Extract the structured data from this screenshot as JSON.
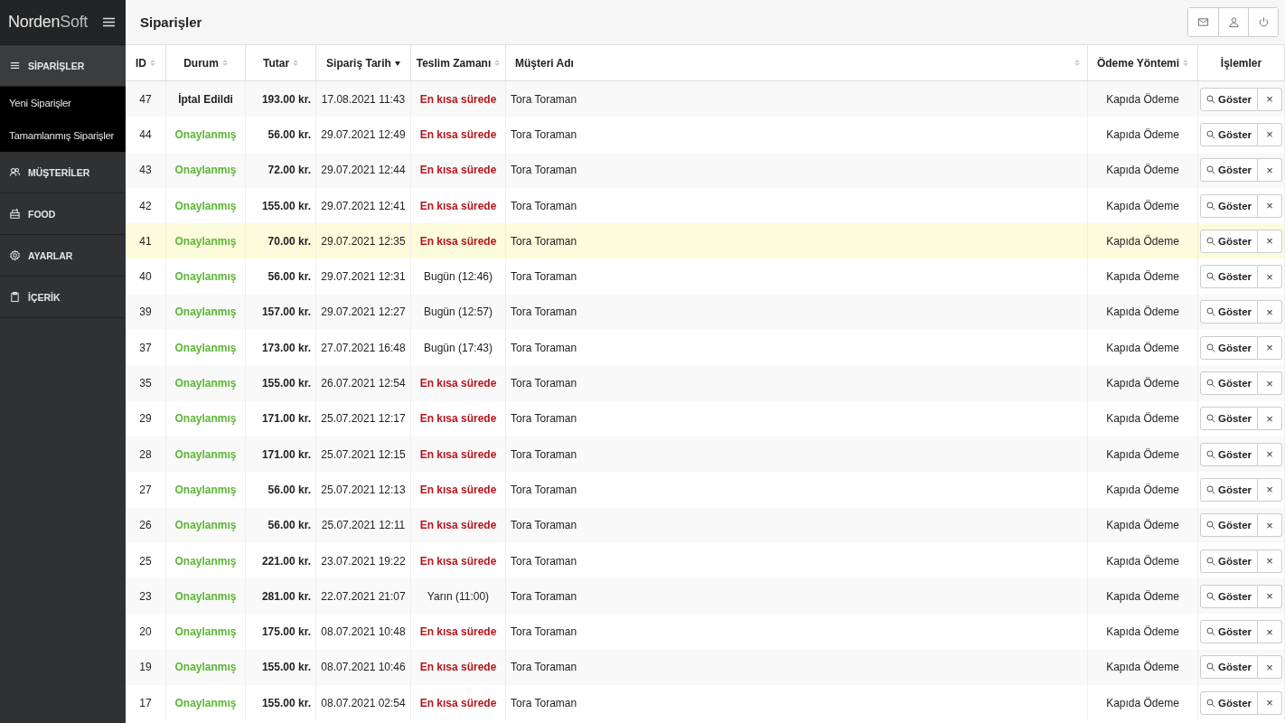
{
  "sidebar": {
    "logo": {
      "main": "Norden",
      "light": "Soft"
    },
    "items": [
      {
        "label": "SİPARİŞLER",
        "kind": "list",
        "children": [
          {
            "label": "Yeni Siparişler"
          },
          {
            "label": "Tamamlanmış Siparişler"
          }
        ]
      },
      {
        "label": "MÜŞTERİLER",
        "kind": "users"
      },
      {
        "label": "FOOD",
        "kind": "food"
      },
      {
        "label": "AYARLAR",
        "kind": "gear"
      },
      {
        "label": "İÇERİK",
        "kind": "clipboard"
      }
    ]
  },
  "header": {
    "title": "Siparişler"
  },
  "table": {
    "columns": [
      {
        "label": "ID",
        "sortable": true,
        "sorted": false
      },
      {
        "label": "Durum",
        "sortable": true,
        "sorted": false
      },
      {
        "label": "Tutar",
        "sortable": true,
        "sorted": false
      },
      {
        "label": "Sipariş Tarih",
        "sortable": true,
        "sorted": true
      },
      {
        "label": "Teslim Zamanı",
        "sortable": true,
        "sorted": false
      },
      {
        "label": "Müşteri Adı",
        "sortable": true,
        "sorted": false
      },
      {
        "label": "Ödeme Yöntemi",
        "sortable": true,
        "sorted": false
      },
      {
        "label": "İşlemler",
        "sortable": false,
        "sorted": false
      }
    ],
    "rows": [
      {
        "id": "47",
        "status": "İptal Edildi",
        "cancelled": true,
        "amount": "193.00 kr.",
        "date": "17.08.2021 11:43",
        "delivery": "En kısa sürede",
        "urgent": true,
        "customer": "Tora Toraman",
        "payment": "Kapıda Ödeme",
        "highlighted": false,
        "show": "Göster",
        "remove": "×"
      },
      {
        "id": "44",
        "status": "Onaylanmış",
        "cancelled": false,
        "amount": "56.00 kr.",
        "date": "29.07.2021 12:49",
        "delivery": "En kısa sürede",
        "urgent": true,
        "customer": "Tora Toraman",
        "payment": "Kapıda Ödeme",
        "highlighted": false,
        "show": "Göster",
        "remove": "×"
      },
      {
        "id": "43",
        "status": "Onaylanmış",
        "cancelled": false,
        "amount": "72.00 kr.",
        "date": "29.07.2021 12:44",
        "delivery": "En kısa sürede",
        "urgent": true,
        "customer": "Tora Toraman",
        "payment": "Kapıda Ödeme",
        "highlighted": false,
        "show": "Göster",
        "remove": "×"
      },
      {
        "id": "42",
        "status": "Onaylanmış",
        "cancelled": false,
        "amount": "155.00 kr.",
        "date": "29.07.2021 12:41",
        "delivery": "En kısa sürede",
        "urgent": true,
        "customer": "Tora Toraman",
        "payment": "Kapıda Ödeme",
        "highlighted": false,
        "show": "Göster",
        "remove": "×"
      },
      {
        "id": "41",
        "status": "Onaylanmış",
        "cancelled": false,
        "amount": "70.00 kr.",
        "date": "29.07.2021 12:35",
        "delivery": "En kısa sürede",
        "urgent": true,
        "customer": "Tora Toraman",
        "payment": "Kapıda Ödeme",
        "highlighted": true,
        "show": "Göster",
        "remove": "×"
      },
      {
        "id": "40",
        "status": "Onaylanmış",
        "cancelled": false,
        "amount": "56.00 kr.",
        "date": "29.07.2021 12:31",
        "delivery": "Bugün (12:46)",
        "urgent": false,
        "customer": "Tora Toraman",
        "payment": "Kapıda Ödeme",
        "highlighted": false,
        "show": "Göster",
        "remove": "×"
      },
      {
        "id": "39",
        "status": "Onaylanmış",
        "cancelled": false,
        "amount": "157.00 kr.",
        "date": "29.07.2021 12:27",
        "delivery": "Bugün (12:57)",
        "urgent": false,
        "customer": "Tora Toraman",
        "payment": "Kapıda Ödeme",
        "highlighted": false,
        "show": "Göster",
        "remove": "×"
      },
      {
        "id": "37",
        "status": "Onaylanmış",
        "cancelled": false,
        "amount": "173.00 kr.",
        "date": "27.07.2021 16:48",
        "delivery": "Bugün (17:43)",
        "urgent": false,
        "customer": "Tora Toraman",
        "payment": "Kapıda Ödeme",
        "highlighted": false,
        "show": "Göster",
        "remove": "×"
      },
      {
        "id": "35",
        "status": "Onaylanmış",
        "cancelled": false,
        "amount": "155.00 kr.",
        "date": "26.07.2021 12:54",
        "delivery": "En kısa sürede",
        "urgent": true,
        "customer": "Tora Toraman",
        "payment": "Kapıda Ödeme",
        "highlighted": false,
        "show": "Göster",
        "remove": "×"
      },
      {
        "id": "29",
        "status": "Onaylanmış",
        "cancelled": false,
        "amount": "171.00 kr.",
        "date": "25.07.2021 12:17",
        "delivery": "En kısa sürede",
        "urgent": true,
        "customer": "Tora Toraman",
        "payment": "Kapıda Ödeme",
        "highlighted": false,
        "show": "Göster",
        "remove": "×"
      },
      {
        "id": "28",
        "status": "Onaylanmış",
        "cancelled": false,
        "amount": "171.00 kr.",
        "date": "25.07.2021 12:15",
        "delivery": "En kısa sürede",
        "urgent": true,
        "customer": "Tora Toraman",
        "payment": "Kapıda Ödeme",
        "highlighted": false,
        "show": "Göster",
        "remove": "×"
      },
      {
        "id": "27",
        "status": "Onaylanmış",
        "cancelled": false,
        "amount": "56.00 kr.",
        "date": "25.07.2021 12:13",
        "delivery": "En kısa sürede",
        "urgent": true,
        "customer": "Tora Toraman",
        "payment": "Kapıda Ödeme",
        "highlighted": false,
        "show": "Göster",
        "remove": "×"
      },
      {
        "id": "26",
        "status": "Onaylanmış",
        "cancelled": false,
        "amount": "56.00 kr.",
        "date": "25.07.2021 12:11",
        "delivery": "En kısa sürede",
        "urgent": true,
        "customer": "Tora Toraman",
        "payment": "Kapıda Ödeme",
        "highlighted": false,
        "show": "Göster",
        "remove": "×"
      },
      {
        "id": "25",
        "status": "Onaylanmış",
        "cancelled": false,
        "amount": "221.00 kr.",
        "date": "23.07.2021 19:22",
        "delivery": "En kısa sürede",
        "urgent": true,
        "customer": "Tora Toraman",
        "payment": "Kapıda Ödeme",
        "highlighted": false,
        "show": "Göster",
        "remove": "×"
      },
      {
        "id": "23",
        "status": "Onaylanmış",
        "cancelled": false,
        "amount": "281.00 kr.",
        "date": "22.07.2021 21:07",
        "delivery": "Yarın (11:00)",
        "urgent": false,
        "customer": "Tora Toraman",
        "payment": "Kapıda Ödeme",
        "highlighted": false,
        "show": "Göster",
        "remove": "×"
      },
      {
        "id": "20",
        "status": "Onaylanmış",
        "cancelled": false,
        "amount": "175.00 kr.",
        "date": "08.07.2021 10:48",
        "delivery": "En kısa sürede",
        "urgent": true,
        "customer": "Tora Toraman",
        "payment": "Kapıda Ödeme",
        "highlighted": false,
        "show": "Göster",
        "remove": "×"
      },
      {
        "id": "19",
        "status": "Onaylanmış",
        "cancelled": false,
        "amount": "155.00 kr.",
        "date": "08.07.2021 10:46",
        "delivery": "En kısa sürede",
        "urgent": true,
        "customer": "Tora Toraman",
        "payment": "Kapıda Ödeme",
        "highlighted": false,
        "show": "Göster",
        "remove": "×"
      },
      {
        "id": "17",
        "status": "Onaylanmış",
        "cancelled": false,
        "amount": "155.00 kr.",
        "date": "08.07.2021 02:54",
        "delivery": "En kısa sürede",
        "urgent": true,
        "customer": "Tora Toraman",
        "payment": "Kapıda Ödeme",
        "highlighted": false,
        "show": "Göster",
        "remove": "×"
      }
    ]
  }
}
